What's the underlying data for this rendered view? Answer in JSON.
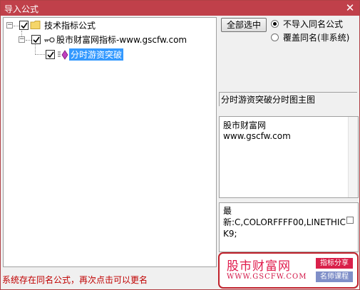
{
  "window": {
    "title": "导入公式",
    "close_glyph": "✕"
  },
  "tree": {
    "root_label": "技术指标公式",
    "group_label": "股市财富网指标-www.gscfw.com",
    "formula_label": "分时游资突破"
  },
  "controls": {
    "select_all_button": "全部选中",
    "radio_no_import": "不导入同名公式",
    "radio_overwrite": "覆盖同名(非系统)"
  },
  "formula_desc": "分时游资突破分时图主图",
  "info_box": {
    "line1": "股市财富网",
    "line2": "www.gscfw.com"
  },
  "code_box": {
    "line1": "最",
    "line2": "新:C,COLORFFFF00,LINETHIC",
    "line3": "K9;"
  },
  "status_text": "系统存在同名公式，再次点击可以更名",
  "banner": {
    "brand": "股市财富网",
    "url": "WWW.GSCFW.COM",
    "tag1": "指标分享",
    "tag2": "名师课程"
  },
  "colors": {
    "titlebar": "#c0404a",
    "selection": "#3399ff",
    "status": "#c00000",
    "banner_border": "#c0212b"
  }
}
